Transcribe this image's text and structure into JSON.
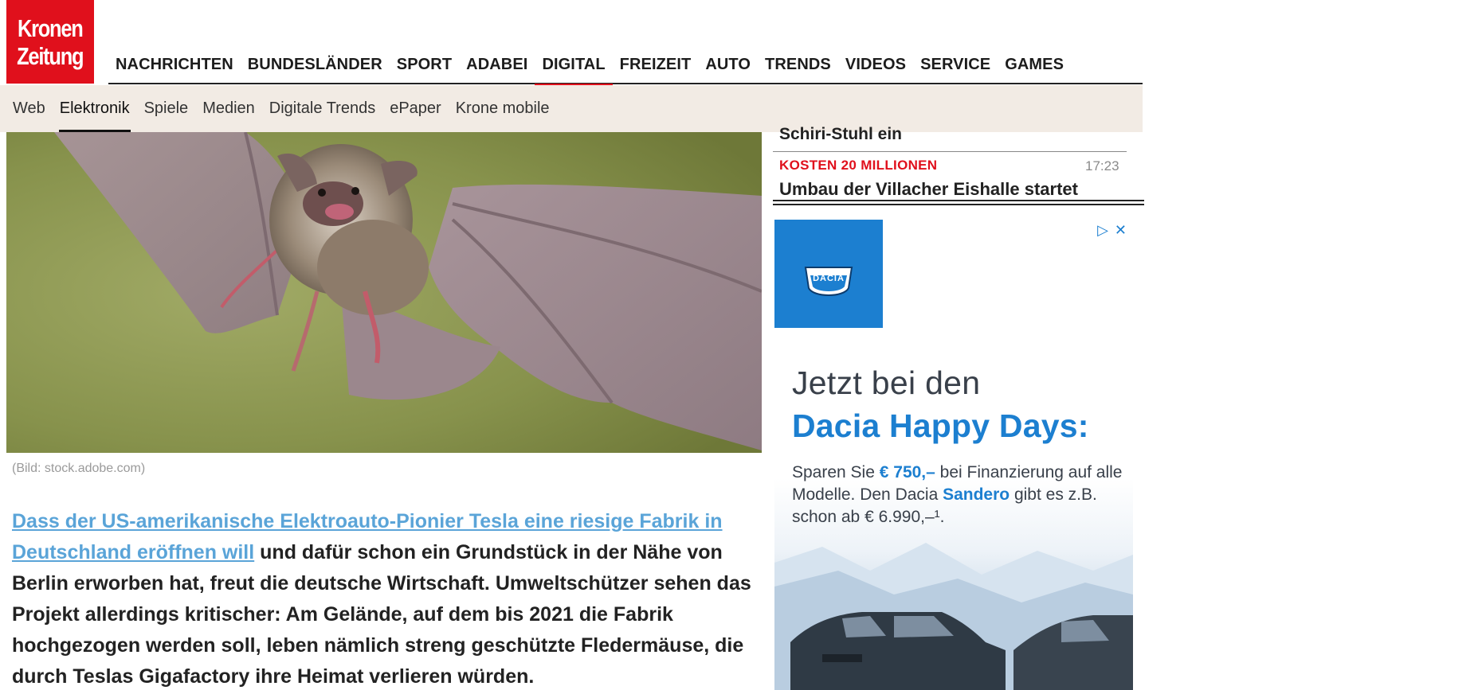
{
  "logo": {
    "line1": "Kronen",
    "line2": "Zeitung"
  },
  "mainnav": [
    {
      "label": "NACHRICHTEN",
      "active": false
    },
    {
      "label": "BUNDESLÄNDER",
      "active": false
    },
    {
      "label": "SPORT",
      "active": false
    },
    {
      "label": "ADABEI",
      "active": false
    },
    {
      "label": "DIGITAL",
      "active": true
    },
    {
      "label": "FREIZEIT",
      "active": false
    },
    {
      "label": "AUTO",
      "active": false
    },
    {
      "label": "TRENDS",
      "active": false
    },
    {
      "label": "VIDEOS",
      "active": false
    },
    {
      "label": "SERVICE",
      "active": false
    },
    {
      "label": "GAMES",
      "active": false
    }
  ],
  "subnav": [
    {
      "label": "Web",
      "active": false
    },
    {
      "label": "Elektronik",
      "active": true
    },
    {
      "label": "Spiele",
      "active": false
    },
    {
      "label": "Medien",
      "active": false
    },
    {
      "label": "Digitale Trends",
      "active": false
    },
    {
      "label": "ePaper",
      "active": false
    },
    {
      "label": "Krone mobile",
      "active": false
    }
  ],
  "hero": {
    "caption": "(Bild: stock.adobe.com)"
  },
  "article": {
    "link_text": "Dass der US-amerikanische Elektroauto-Pionier Tesla eine riesige Fabrik in Deutschland eröffnen will",
    "body_text": " und dafür schon ein Grundstück in der Nähe von Berlin erworben hat, freut die deutsche Wirtschaft. Umweltschützer sehen das Projekt allerdings kritischer: Am Gelände, auf dem bis 2021 die Fabrik hochgezogen werden soll, leben nämlich streng geschützte Fledermäuse, die durch Teslas Gigafactory ihre Heimat verlieren würden."
  },
  "sidebar": {
    "partial_headline": "Schiri-Stuhl ein",
    "kicker": "KOSTEN 20 MILLIONEN",
    "time": "17:23",
    "headline": "Umbau der Villacher Eishalle startet"
  },
  "ad": {
    "brand": "DACIA",
    "line1": "Jetzt bei den",
    "line2": "Dacia Happy Days:",
    "body_part1": "Sparen Sie ",
    "amount": "€ 750,–",
    "body_part2": " bei Finanzierung auf alle Modelle. Den Dacia ",
    "model": "Sandero",
    "body_part3": " gibt es z.B. schon ab € 6.990,–¹.",
    "controls": {
      "adchoices_icon": "play-triangle-icon",
      "close_icon": "close-icon"
    },
    "colors": {
      "brand_blue": "#1c7fd0",
      "text_gray": "#39404a"
    }
  },
  "colors": {
    "brand_red": "#e0101c",
    "subnav_bg": "#f2ebe4",
    "link_blue": "#5aa4d8"
  }
}
